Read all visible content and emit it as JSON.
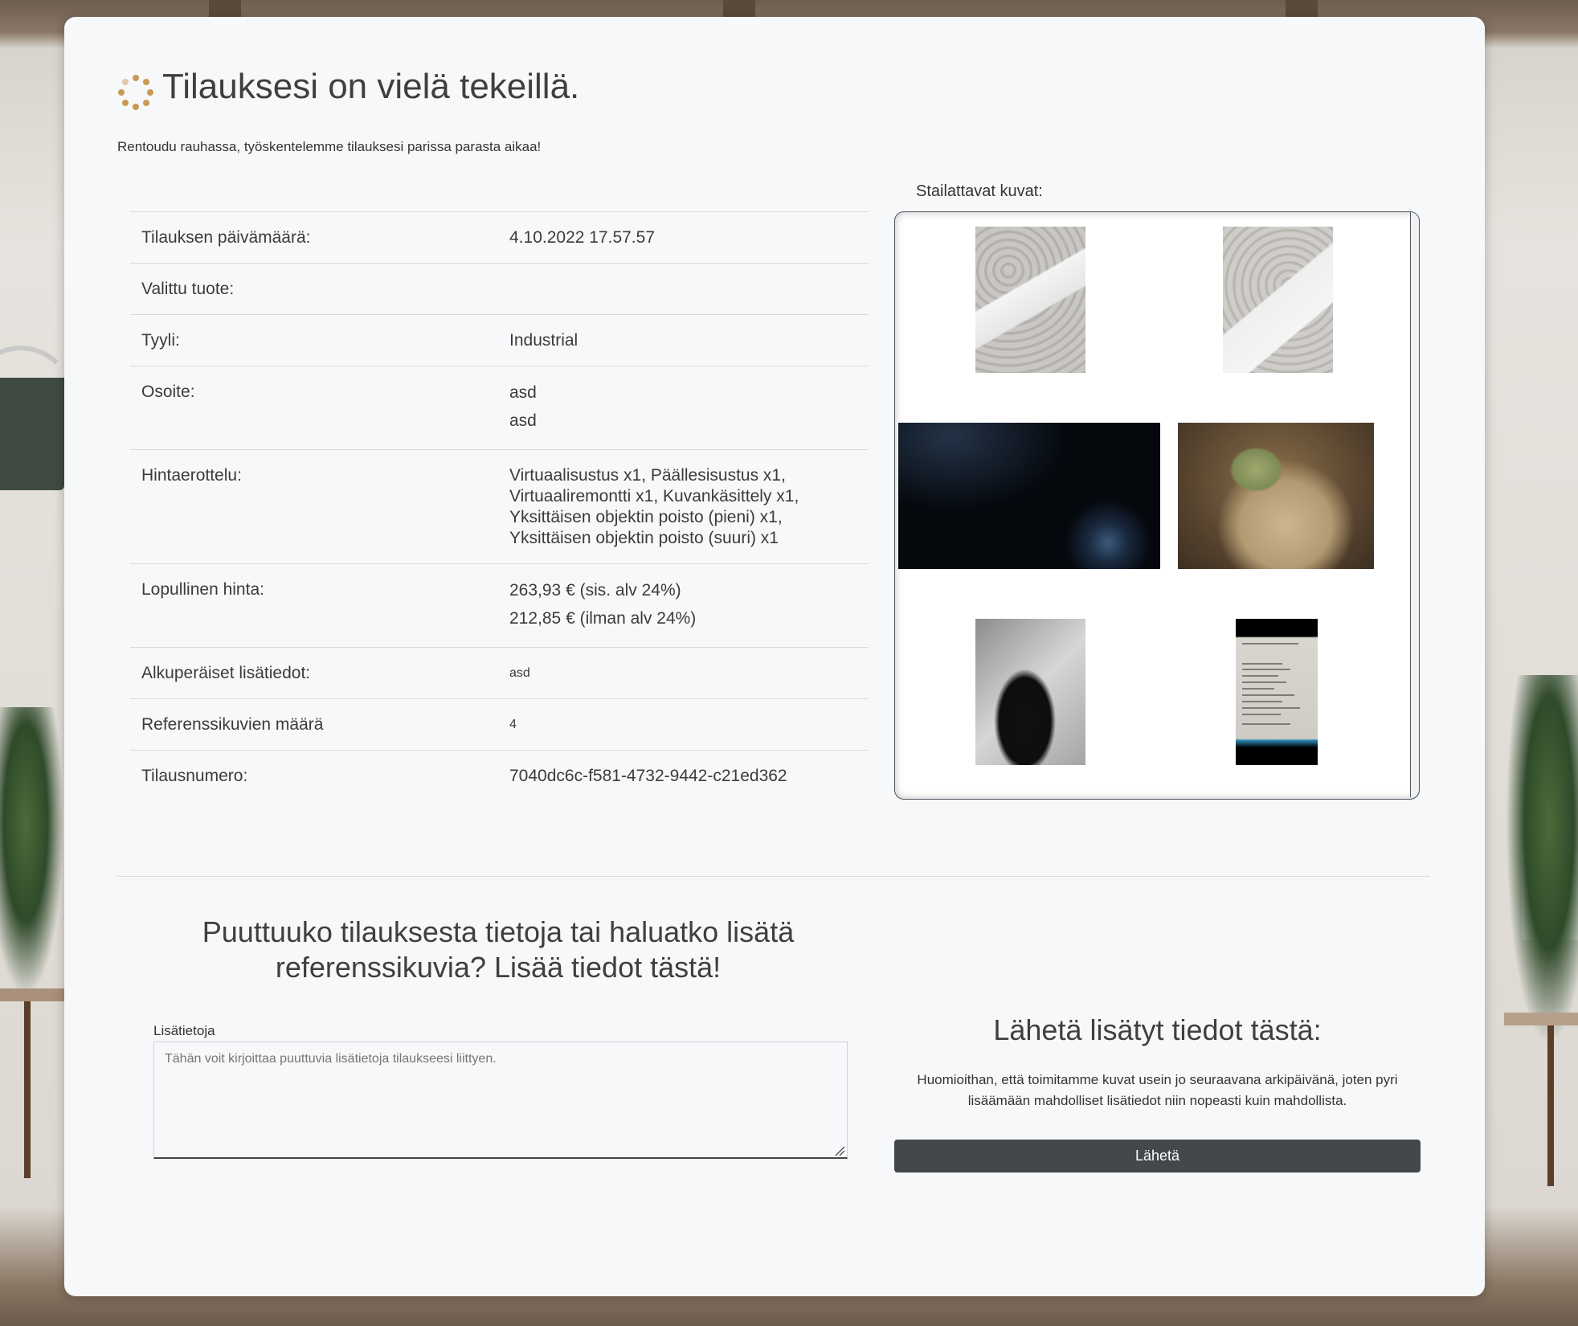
{
  "header": {
    "title": "Tilauksesi on vielä tekeillä.",
    "subtitle": "Rentoudu rauhassa, työskentelemme tilauksesi parissa parasta aikaa!"
  },
  "order": {
    "rows": [
      {
        "label": "Tilauksen päivämäärä:",
        "value": "4.10.2022 17.57.57"
      },
      {
        "label": "Valittu tuote:",
        "value": ""
      },
      {
        "label": "Tyyli:",
        "value": "Industrial"
      },
      {
        "label": "Osoite:",
        "lines": [
          "asd",
          "asd"
        ]
      },
      {
        "label": "Hintaerottelu:",
        "value": "Virtuaalisustus x1, Päällesisustus x1, Virtuaaliremontti x1, Kuvankäsittely x1, Yksittäisen objektin poisto (pieni) x1, Yksittäisen objektin poisto (suuri) x1"
      },
      {
        "label": "Lopullinen hinta:",
        "lines": [
          "263,93 € (sis. alv 24%)",
          "212,85 € (ilman alv 24%)"
        ]
      },
      {
        "label": "Alkuperäiset lisätiedot:",
        "value": "asd"
      },
      {
        "label": "Referenssikuvien määrä",
        "value": "4"
      },
      {
        "label": "Tilausnumero:",
        "value": "7040dc6c-f581-4732-9442-c21ed362"
      }
    ]
  },
  "gallery": {
    "label": "Stailattavat kuvat:"
  },
  "additional": {
    "heading": "Puuttuuko tilauksesta tietoja tai haluatko lisätä referenssikuvia? Lisää tiedot tästä!",
    "field_label": "Lisätietoja",
    "placeholder": "Tähän voit kirjoittaa puuttuvia lisätietoja tilaukseesi liittyen."
  },
  "send": {
    "heading": "Lähetä lisätyt tiedot tästä:",
    "note": "Huomioithan, että toimitamme kuvat usein jo seuraavana arkipäivänä, joten pyri lisäämään mahdolliset lisätiedot niin nopeasti kuin mahdollista.",
    "button_label": "Lähetä"
  },
  "colors": {
    "spinner": "#c99a55",
    "button_bg": "#44484d",
    "card_bg": "#f7f8fa"
  }
}
